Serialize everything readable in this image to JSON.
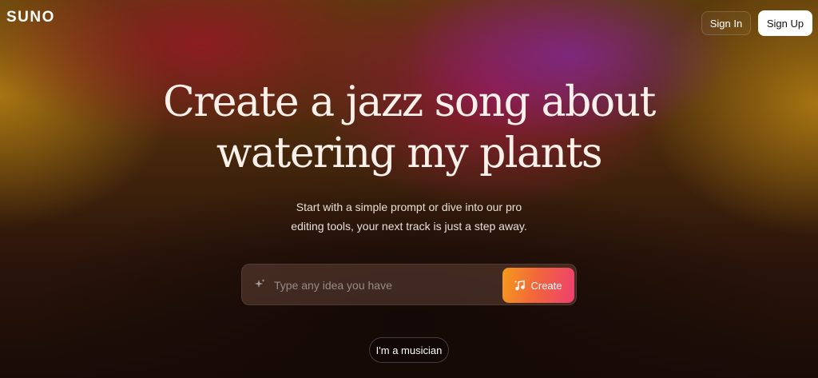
{
  "header": {
    "logo_text": "SUNO",
    "sign_in_label": "Sign In",
    "sign_up_label": "Sign Up"
  },
  "hero": {
    "headline_line1": "Create a jazz song about",
    "headline_line2": "watering my plants",
    "subtitle_line1": "Start with a simple prompt or dive into our pro",
    "subtitle_line2": "editing tools, your next track is just a step away."
  },
  "prompt": {
    "placeholder": "Type any idea you have",
    "value": "",
    "icon": "sparkle-icon",
    "create_label": "Create",
    "create_icon": "music-note-icon"
  },
  "secondary": {
    "musician_label": "I'm a musician"
  },
  "colors": {
    "create_gradient_start": "#f59a1c",
    "create_gradient_end": "#ee3f6f",
    "sign_up_bg": "#ffffff"
  }
}
